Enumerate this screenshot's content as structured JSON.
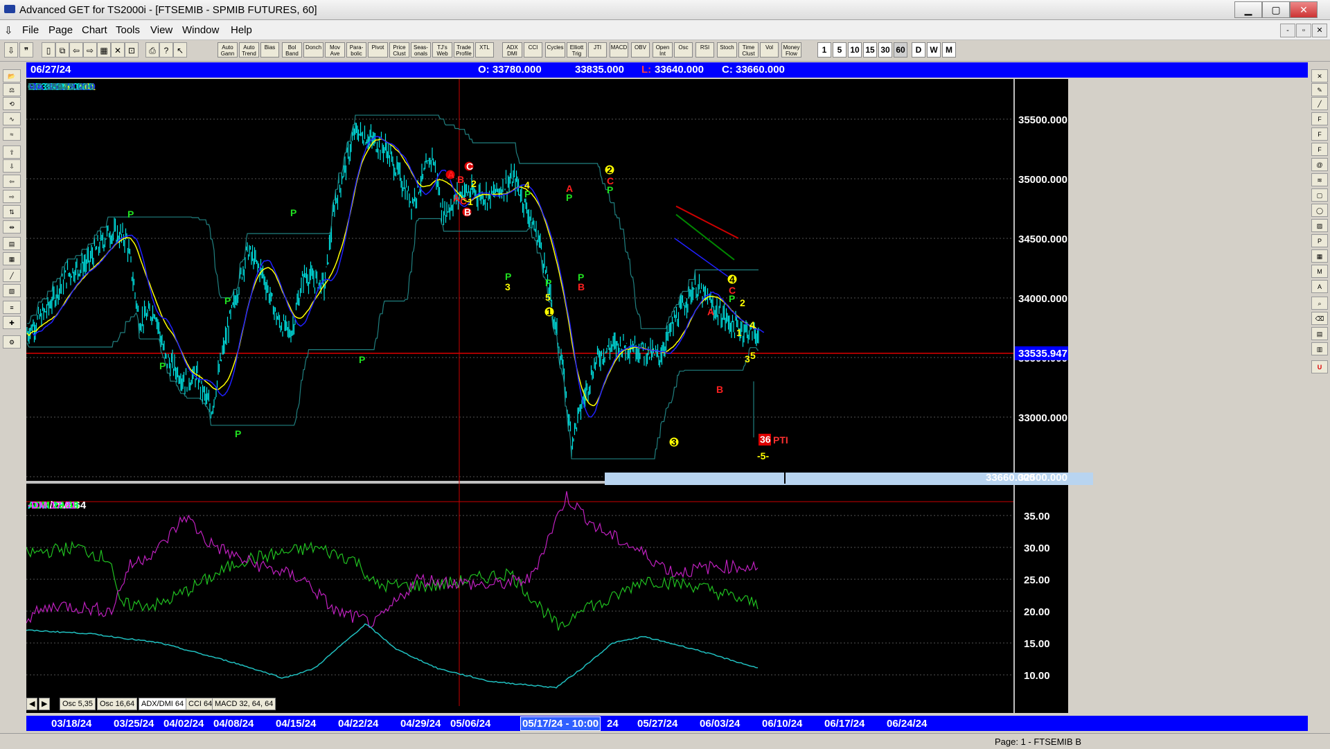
{
  "window": {
    "title": "Advanced GET for TS2000i - [FTSEMIB - SPMIB FUTURES, 60]",
    "controls": {
      "minimize": "▁",
      "maximize": "▢",
      "close": "✕"
    }
  },
  "menu": {
    "items": [
      "File",
      "Page",
      "Chart",
      "Tools",
      "View",
      "Window",
      "Help"
    ],
    "mdi": {
      "minimize": "-",
      "restore": "▫",
      "close": "✕"
    }
  },
  "toolbar": {
    "study_buttons": [
      "Auto Gann",
      "Auto Trend",
      "Bias",
      "Bol Band",
      "Donch",
      "Mov Ave",
      "Para-bolic",
      "Pivot",
      "Price Clust",
      "Seas-onals",
      "TJ's Web",
      "Trade Profile",
      "XTL",
      "ADX DMI",
      "CCI",
      "Cycles",
      "Elliott Trig",
      "JTI",
      "MACD",
      "OBV",
      "Open Int",
      "Osc",
      "RSI",
      "Stoch",
      "Time Clust",
      "Vol",
      "Money Flow"
    ],
    "timeframes": [
      "1",
      "5",
      "10",
      "15",
      "30",
      "60",
      "D",
      "W",
      "M"
    ],
    "active_timeframe": "60"
  },
  "infobar": {
    "date": "06/27/24",
    "open": "O: 33780.000",
    "high": "33835.000",
    "low_label": "L:",
    "low": "33640.000",
    "close": "C: 33660.000"
  },
  "legend": [
    {
      "text": "OP 35365.000",
      "color": "#00e5e5"
    },
    {
      "text": "HI  35425.000",
      "color": "#00e5e5"
    },
    {
      "text": "LO  35340.000",
      "color": "#00e5e5"
    },
    {
      "text": "CL  35395.000",
      "color": "#00e5e5"
    },
    {
      "text": "MA  35159.141",
      "color": "#ffff00"
    },
    {
      "text": "MA  35179.219",
      "color": "#2020ff"
    },
    {
      "text": "DC  35445.000",
      "color": "#208080"
    },
    {
      "text": "DC  33975.000",
      "color": "#208080"
    }
  ],
  "price_scale": [
    "35500.000",
    "35000.000",
    "34500.000",
    "34000.000",
    "33500.000",
    "33000.000",
    "32500.000"
  ],
  "current_price_tag": "33535.947",
  "bottom_price_tag": "33660.000",
  "pti": {
    "value": "36",
    "label": "PTI",
    "wave": "-5-"
  },
  "wave_labels": {
    "A": "A",
    "B": "B",
    "C": "C",
    "P": "P",
    "n1": "1",
    "n2": "2",
    "n3": "3",
    "n4": "4",
    "n5": "5"
  },
  "indicator": {
    "title": "ADX/DMI 64",
    "adx": "ADX 15.89",
    "pdm": "+DM 29.46",
    "mdm": "-DM 17.81",
    "scale": [
      "35.00",
      "30.00",
      "25.00",
      "20.00",
      "15.00",
      "10.00"
    ]
  },
  "tabs": [
    "Osc 5,35",
    "Osc 16,64",
    "ADX/DMI 64",
    "CCI 64",
    "MACD 32, 64, 64"
  ],
  "active_tab": "ADX/DMI 64",
  "dates": [
    "03/18/24",
    "03/25/24",
    "04/02/24",
    "04/08/24",
    "04/15/24",
    "04/22/24",
    "04/29/24",
    "05/06/24",
    "05/17/24 - 10:00",
    "24",
    "05/27/24",
    "06/03/24",
    "06/10/24",
    "06/17/24",
    "06/24/24"
  ],
  "status": "Page: 1 - FTSEMIB B",
  "colors": {
    "price": "#00e5e5",
    "ma_fast": "#ffff00",
    "ma_slow": "#2020ff",
    "donchian": "#208080",
    "pdm": "#20c020",
    "mdm": "#c020c0",
    "adx": "#20c0c0",
    "red": "#ff2020",
    "green": "#20e020"
  }
}
